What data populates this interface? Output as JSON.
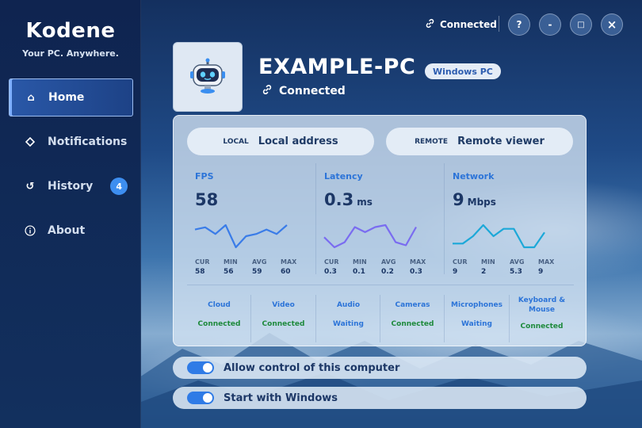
{
  "app": {
    "brand": "Kodene",
    "tagline": "Your PC. Anywhere."
  },
  "sidebar": {
    "items": [
      {
        "label": "Home",
        "icon": "home-icon",
        "active": true
      },
      {
        "label": "Notifications",
        "icon": "diamond-icon"
      },
      {
        "label": "History",
        "icon": "refresh-icon",
        "badge": "4"
      },
      {
        "label": "About",
        "icon": "info-icon"
      }
    ]
  },
  "topbar": {
    "status": "Connected",
    "buttons": {
      "help": "?",
      "minimize": "-",
      "maximize": "□",
      "close": "×"
    }
  },
  "device": {
    "name": "EXAMPLE-PC",
    "type": "Windows PC",
    "status": "Connected"
  },
  "addresses": {
    "local": {
      "tag": "LOCAL",
      "text": "Local address"
    },
    "remote": {
      "tag": "REMOTE",
      "text": "Remote viewer"
    }
  },
  "metrics": [
    {
      "label": "FPS",
      "value": "58",
      "unit": "",
      "color": "#3a7ce8",
      "spark": [
        58,
        59,
        56,
        60,
        50,
        55,
        56,
        58,
        56,
        60
      ],
      "stats": {
        "cur": "58",
        "min": "56",
        "avg": "59",
        "max": "60"
      }
    },
    {
      "label": "Latency",
      "value": "0.3",
      "unit": "ms",
      "color": "#7a6cf0",
      "spark": [
        0.2,
        0.1,
        0.15,
        0.3,
        0.25,
        0.3,
        0.32,
        0.15,
        0.12,
        0.3
      ],
      "stats": {
        "cur": "0.3",
        "min": "0.1",
        "avg": "0.2",
        "max": "0.3"
      }
    },
    {
      "label": "Network",
      "value": "9",
      "unit": "Mbps",
      "color": "#1ca8d8",
      "spark": [
        4,
        4,
        6,
        9,
        6,
        8,
        8,
        3,
        3,
        7
      ],
      "stats": {
        "cur": "9",
        "min": "2",
        "avg": "5.3",
        "max": "9"
      }
    }
  ],
  "stat_labels": {
    "cur": "CUR",
    "min": "MIN",
    "avg": "AVG",
    "max": "MAX"
  },
  "services": [
    {
      "name": "Cloud",
      "status": "Connected",
      "state": "ok"
    },
    {
      "name": "Video",
      "status": "Connected",
      "state": "ok"
    },
    {
      "name": "Audio",
      "status": "Waiting",
      "state": "wait"
    },
    {
      "name": "Cameras",
      "status": "Connected",
      "state": "ok"
    },
    {
      "name": "Microphones",
      "status": "Waiting",
      "state": "wait"
    },
    {
      "name": "Keyboard & Mouse",
      "status": "Connected",
      "state": "ok"
    }
  ],
  "toggles": [
    {
      "label": "Allow control of this computer",
      "on": true
    },
    {
      "label": "Start with Windows",
      "on": true
    }
  ],
  "colors": {
    "accent": "#2f7be6",
    "ok": "#1e8a3c",
    "info": "#2c74d8"
  }
}
